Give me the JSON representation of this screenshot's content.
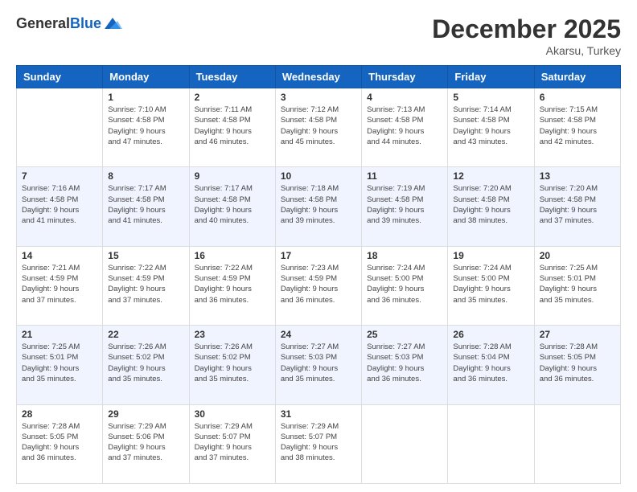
{
  "logo": {
    "general": "General",
    "blue": "Blue"
  },
  "header": {
    "title": "December 2025",
    "subtitle": "Akarsu, Turkey"
  },
  "weekdays": [
    "Sunday",
    "Monday",
    "Tuesday",
    "Wednesday",
    "Thursday",
    "Friday",
    "Saturday"
  ],
  "weeks": [
    [
      {
        "day": "",
        "sunrise": "",
        "sunset": "",
        "daylight": ""
      },
      {
        "day": "1",
        "sunrise": "7:10 AM",
        "sunset": "4:58 PM",
        "daylight": "9 hours and 47 minutes."
      },
      {
        "day": "2",
        "sunrise": "7:11 AM",
        "sunset": "4:58 PM",
        "daylight": "9 hours and 46 minutes."
      },
      {
        "day": "3",
        "sunrise": "7:12 AM",
        "sunset": "4:58 PM",
        "daylight": "9 hours and 45 minutes."
      },
      {
        "day": "4",
        "sunrise": "7:13 AM",
        "sunset": "4:58 PM",
        "daylight": "9 hours and 44 minutes."
      },
      {
        "day": "5",
        "sunrise": "7:14 AM",
        "sunset": "4:58 PM",
        "daylight": "9 hours and 43 minutes."
      },
      {
        "day": "6",
        "sunrise": "7:15 AM",
        "sunset": "4:58 PM",
        "daylight": "9 hours and 42 minutes."
      }
    ],
    [
      {
        "day": "7",
        "sunrise": "7:16 AM",
        "sunset": "4:58 PM",
        "daylight": "9 hours and 41 minutes."
      },
      {
        "day": "8",
        "sunrise": "7:17 AM",
        "sunset": "4:58 PM",
        "daylight": "9 hours and 41 minutes."
      },
      {
        "day": "9",
        "sunrise": "7:17 AM",
        "sunset": "4:58 PM",
        "daylight": "9 hours and 40 minutes."
      },
      {
        "day": "10",
        "sunrise": "7:18 AM",
        "sunset": "4:58 PM",
        "daylight": "9 hours and 39 minutes."
      },
      {
        "day": "11",
        "sunrise": "7:19 AM",
        "sunset": "4:58 PM",
        "daylight": "9 hours and 39 minutes."
      },
      {
        "day": "12",
        "sunrise": "7:20 AM",
        "sunset": "4:58 PM",
        "daylight": "9 hours and 38 minutes."
      },
      {
        "day": "13",
        "sunrise": "7:20 AM",
        "sunset": "4:58 PM",
        "daylight": "9 hours and 37 minutes."
      }
    ],
    [
      {
        "day": "14",
        "sunrise": "7:21 AM",
        "sunset": "4:59 PM",
        "daylight": "9 hours and 37 minutes."
      },
      {
        "day": "15",
        "sunrise": "7:22 AM",
        "sunset": "4:59 PM",
        "daylight": "9 hours and 37 minutes."
      },
      {
        "day": "16",
        "sunrise": "7:22 AM",
        "sunset": "4:59 PM",
        "daylight": "9 hours and 36 minutes."
      },
      {
        "day": "17",
        "sunrise": "7:23 AM",
        "sunset": "4:59 PM",
        "daylight": "9 hours and 36 minutes."
      },
      {
        "day": "18",
        "sunrise": "7:24 AM",
        "sunset": "5:00 PM",
        "daylight": "9 hours and 36 minutes."
      },
      {
        "day": "19",
        "sunrise": "7:24 AM",
        "sunset": "5:00 PM",
        "daylight": "9 hours and 35 minutes."
      },
      {
        "day": "20",
        "sunrise": "7:25 AM",
        "sunset": "5:01 PM",
        "daylight": "9 hours and 35 minutes."
      }
    ],
    [
      {
        "day": "21",
        "sunrise": "7:25 AM",
        "sunset": "5:01 PM",
        "daylight": "9 hours and 35 minutes."
      },
      {
        "day": "22",
        "sunrise": "7:26 AM",
        "sunset": "5:02 PM",
        "daylight": "9 hours and 35 minutes."
      },
      {
        "day": "23",
        "sunrise": "7:26 AM",
        "sunset": "5:02 PM",
        "daylight": "9 hours and 35 minutes."
      },
      {
        "day": "24",
        "sunrise": "7:27 AM",
        "sunset": "5:03 PM",
        "daylight": "9 hours and 35 minutes."
      },
      {
        "day": "25",
        "sunrise": "7:27 AM",
        "sunset": "5:03 PM",
        "daylight": "9 hours and 36 minutes."
      },
      {
        "day": "26",
        "sunrise": "7:28 AM",
        "sunset": "5:04 PM",
        "daylight": "9 hours and 36 minutes."
      },
      {
        "day": "27",
        "sunrise": "7:28 AM",
        "sunset": "5:05 PM",
        "daylight": "9 hours and 36 minutes."
      }
    ],
    [
      {
        "day": "28",
        "sunrise": "7:28 AM",
        "sunset": "5:05 PM",
        "daylight": "9 hours and 36 minutes."
      },
      {
        "day": "29",
        "sunrise": "7:29 AM",
        "sunset": "5:06 PM",
        "daylight": "9 hours and 37 minutes."
      },
      {
        "day": "30",
        "sunrise": "7:29 AM",
        "sunset": "5:07 PM",
        "daylight": "9 hours and 37 minutes."
      },
      {
        "day": "31",
        "sunrise": "7:29 AM",
        "sunset": "5:07 PM",
        "daylight": "9 hours and 38 minutes."
      },
      {
        "day": "",
        "sunrise": "",
        "sunset": "",
        "daylight": ""
      },
      {
        "day": "",
        "sunrise": "",
        "sunset": "",
        "daylight": ""
      },
      {
        "day": "",
        "sunrise": "",
        "sunset": "",
        "daylight": ""
      }
    ]
  ],
  "labels": {
    "sunrise": "Sunrise:",
    "sunset": "Sunset:",
    "daylight": "Daylight:"
  }
}
